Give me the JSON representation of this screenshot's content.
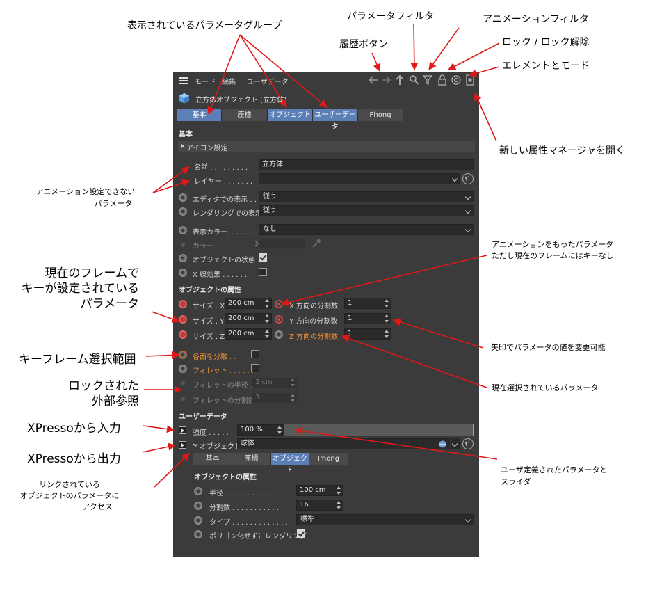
{
  "menu": {
    "mode": "モード",
    "edit": "編集",
    "userdata": "ユーザデータ"
  },
  "object_header": "立方体オブジェクト [立方体]",
  "tabs": [
    "基本",
    "座標",
    "オブジェクト",
    "ユーザーデータ",
    "Phong"
  ],
  "basic": {
    "title": "基本",
    "icon_settings": "アイコン設定",
    "name_label": "名前 . . . . . . . . .",
    "name_value": "立方体",
    "layer_label": "レイヤー . . . . . . .",
    "editor_vis_label": "エディタでの表示 . .",
    "editor_vis_value": "従う",
    "render_vis_label": "レンダリングでの表示",
    "render_vis_value": "従う",
    "display_color_label": "表示カラー. . . . . . .",
    "display_color_value": "なし",
    "color_label": "カラー. . . . . . . . .",
    "object_state_label": "オブジェクトの状態 .",
    "xray_label": "X 線効果 . . . . . ."
  },
  "object_props": {
    "title": "オブジェクトの属性",
    "size_x_label": "サイズ . X",
    "size_x": "200 cm",
    "size_y_label": "サイズ . Y",
    "size_y": "200 cm",
    "size_z_label": "サイズ . Z",
    "size_z": "200 cm",
    "seg_x_label": "X 方向の分割数",
    "seg_x": "1",
    "seg_y_label": "Y 方向の分割数",
    "seg_y": "1",
    "seg_z_label": "Z 方向の分割数",
    "seg_z": "1",
    "separate_label": "各面を分離 . .",
    "fillet_label": "フィレット . . . . . .",
    "fillet_radius_label": "フィレットの半径 .",
    "fillet_radius": "3 cm",
    "fillet_sub_label": "フィレットの分割数",
    "fillet_sub": "3"
  },
  "userdata": {
    "title": "ユーザーデータ",
    "strength_label": "強度 . . . . .",
    "strength_value": "100 %",
    "object_label": "オブジェクト",
    "object_value": "球体",
    "subtabs": [
      "基本",
      "座標",
      "オブジェクト",
      "Phong"
    ],
    "sub_title": "オブジェクトの属性",
    "radius_label": "半径 . . . . . . . . . . . . . .",
    "radius_value": "100 cm",
    "segments_label": "分割数 . . . . . . . . . . . .",
    "segments_value": "16",
    "type_label": "タイプ . . . . . . . . . . . . .",
    "type_value": "標準",
    "render_perfect_label": "ポリゴン化せずにレンダリング"
  },
  "annotations": {
    "param_groups": "表示されているパラメータグループ",
    "param_filter": "パラメータフィルタ",
    "anim_filter": "アニメーションフィルタ",
    "history": "履歴ボタン",
    "lock": "ロック / ロック解除",
    "element_mode": "エレメントとモード",
    "new_manager": "新しい属性マネージャを開く",
    "not_animatable_1": "アニメーション設定できない",
    "not_animatable_2": "パラメータ",
    "animated_1": "アニメーションをもったパラメータ",
    "animated_2": "ただし現在のフレームにはキーなし",
    "keyed_1": "現在のフレームで",
    "keyed_2": "キーが設定されている",
    "keyed_3": "パラメータ",
    "arrows_change": "矢印でパラメータの値を変更可能",
    "keyframe_selection": "キーフレーム選択範囲",
    "current_selected": "現在選択されているパラメータ",
    "locked_1": "ロックされた",
    "locked_2": "外部参照",
    "xp_in": "XPressoから入力",
    "xp_out": "XPressoから出力",
    "user_defined_1": "ユーザ定義されたパラメータと",
    "user_defined_2": "スライダ",
    "linked_1": "リンクされている",
    "linked_2": "オブジェクトのパラメータに",
    "linked_3": "アクセス"
  }
}
